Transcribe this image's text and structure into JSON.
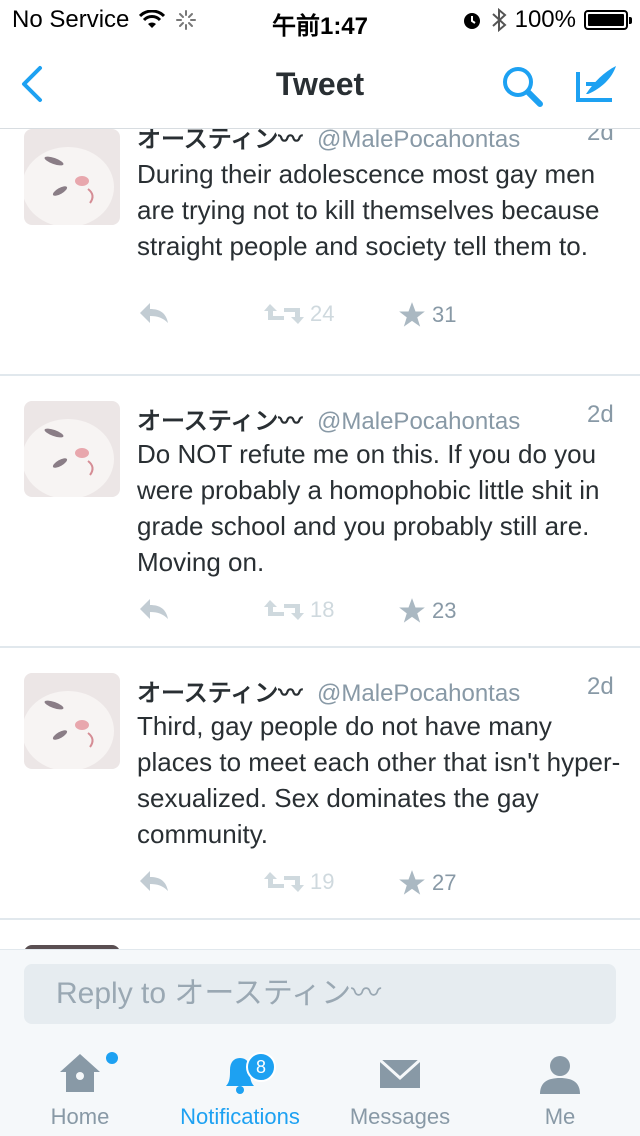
{
  "status_bar": {
    "carrier": "No Service",
    "time": "午前1:47",
    "battery": "100%"
  },
  "navbar": {
    "title": "Tweet"
  },
  "tweets": [
    {
      "name": "オースティン",
      "handle": "@MalePocahontas",
      "time": "2d",
      "text": "During their adolescence most gay men are trying not to kill themselves because straight people and society tell them to.",
      "retweets": "24",
      "likes": "31"
    },
    {
      "name": "オースティン",
      "handle": "@MalePocahontas",
      "time": "2d",
      "text": "Do NOT refute me on this. If you do you were probably a homophobic little shit in grade school and you probably still are. Moving on.",
      "retweets": "18",
      "likes": "23"
    },
    {
      "name": "オースティン",
      "handle": "@MalePocahontas",
      "time": "2d",
      "text": "Third, gay people do not have many places to meet each other that isn't hyper-sexualized. Sex dominates the gay community.",
      "retweets": "19",
      "likes": "27"
    }
  ],
  "reply": {
    "placeholder": "Reply to オースティン"
  },
  "tabs": [
    {
      "label": "Home"
    },
    {
      "label": "Notifications",
      "badge": "8"
    },
    {
      "label": "Messages"
    },
    {
      "label": "Me"
    }
  ],
  "colors": {
    "accent": "#1da1f2",
    "text": "#292f33",
    "muted": "#8899a6"
  }
}
